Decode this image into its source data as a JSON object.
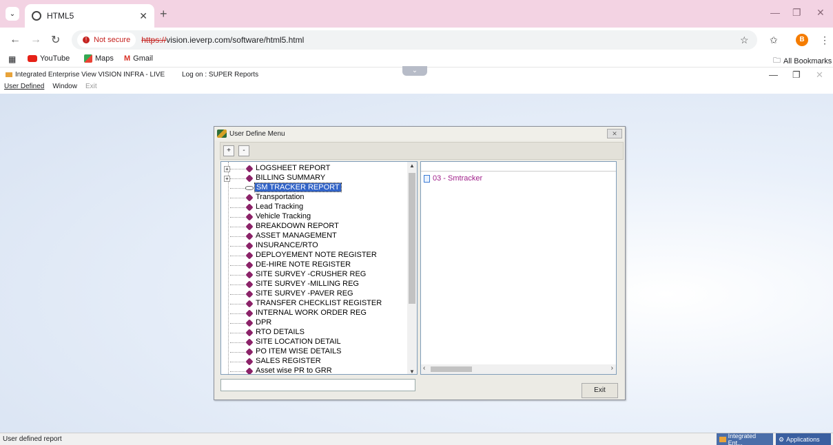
{
  "browser": {
    "tab_title": "HTML5",
    "not_secure": "Not secure",
    "url_scheme": "https://",
    "url_rest": "vision.ieverp.com/software/html5.html",
    "avatar_letter": "B",
    "bookmarks": [
      "YouTube",
      "Maps",
      "Gmail"
    ],
    "all_bookmarks": "All Bookmarks"
  },
  "app": {
    "title": "Integrated Enterprise View  VISION INFRA - LIVE",
    "logon": "Log on : SUPER  Reports",
    "menus": [
      "User Defined",
      "Window",
      "Exit"
    ]
  },
  "dialog": {
    "title": "User Define Menu",
    "toolbar_plus": "+",
    "toolbar_minus": "-",
    "tree_items": [
      {
        "label": "LOGSHEET REPORT",
        "expandable": true
      },
      {
        "label": "BILLING SUMMARY",
        "expandable": true
      },
      {
        "label": "SM TRACKER REPORT",
        "selected": true
      },
      {
        "label": "Transportation"
      },
      {
        "label": "Lead Tracking"
      },
      {
        "label": "Vehicle Tracking"
      },
      {
        "label": "BREAKDOWN REPORT"
      },
      {
        "label": "ASSET MANAGEMENT"
      },
      {
        "label": "INSURANCE/RTO"
      },
      {
        "label": "DEPLOYEMENT NOTE REGISTER"
      },
      {
        "label": "DE-HIRE NOTE REGISTER"
      },
      {
        "label": "SITE SURVEY -CRUSHER REG"
      },
      {
        "label": "SITE SURVEY -MILLING REG"
      },
      {
        "label": "SITE SURVEY -PAVER REG"
      },
      {
        "label": "TRANSFER CHECKLIST REGISTER"
      },
      {
        "label": "INTERNAL WORK ORDER REG"
      },
      {
        "label": "DPR"
      },
      {
        "label": "RTO DETAILS"
      },
      {
        "label": "SITE LOCATION DETAIL"
      },
      {
        "label": "PO ITEM WISE DETAILS"
      },
      {
        "label": "SALES REGISTER"
      },
      {
        "label": "Asset wise PR to GRR"
      }
    ],
    "report_item": "03 - Smtracker",
    "exit_label": "Exit"
  },
  "statusbar": {
    "text": "User defined report",
    "task1": "Integrated Ent...",
    "task2": "Applications"
  }
}
